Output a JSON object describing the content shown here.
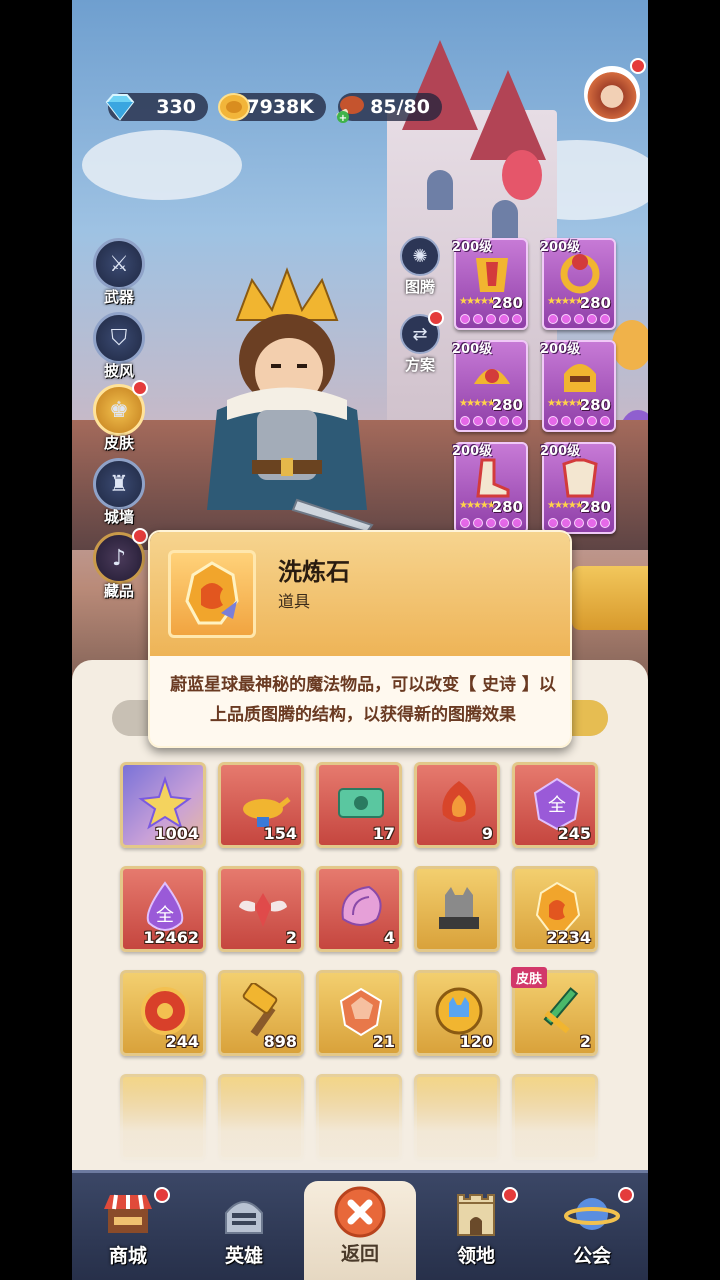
{
  "resources": {
    "gems": "330",
    "gold": "57938K",
    "stamina": "85/80"
  },
  "side_menu": [
    {
      "label": "武器",
      "icon": "weapon-icon",
      "badge": false
    },
    {
      "label": "披风",
      "icon": "cape-icon",
      "badge": false
    },
    {
      "label": "皮肤",
      "icon": "skin-icon",
      "badge": true
    },
    {
      "label": "城墙",
      "icon": "wall-icon",
      "badge": false
    },
    {
      "label": "藏品",
      "icon": "collection-icon",
      "badge": true
    }
  ],
  "mid_menu": [
    {
      "label": "图腾",
      "icon": "totem-icon",
      "badge": false
    },
    {
      "label": "方案",
      "icon": "plan-icon",
      "badge": true
    }
  ],
  "equipment": [
    {
      "level": "200级",
      "value": "280"
    },
    {
      "level": "200级",
      "value": "280"
    },
    {
      "level": "200级",
      "value": "280"
    },
    {
      "level": "200级",
      "value": "280"
    },
    {
      "level": "200级",
      "value": "280"
    },
    {
      "level": "200级",
      "value": "280"
    }
  ],
  "tooltip": {
    "name": "洗炼石",
    "type": "道具",
    "description": "蔚蓝星球最神秘的魔法物品，可以改变【 史诗 】以上品质图腾的结构，以获得新的图腾效果"
  },
  "inventory": [
    {
      "count": "1004",
      "icon": "star-crystal-icon",
      "bg": "purple"
    },
    {
      "count": "154",
      "icon": "magic-lamp-icon",
      "bg": "red"
    },
    {
      "count": "17",
      "icon": "ticket-icon",
      "bg": "red"
    },
    {
      "count": "9",
      "icon": "fire-ore-icon",
      "bg": "red"
    },
    {
      "count": "245",
      "icon": "purple-gem-icon",
      "bg": "red"
    },
    {
      "count": "12462",
      "icon": "purple-drop-icon",
      "bg": "red"
    },
    {
      "count": "2",
      "icon": "winged-crystal-icon",
      "bg": "red"
    },
    {
      "count": "4",
      "icon": "conch-icon",
      "bg": "red"
    },
    {
      "count": "",
      "icon": "cat-statue-icon",
      "bg": "gold"
    },
    {
      "count": "2234",
      "icon": "refining-stone-icon",
      "bg": "gold"
    },
    {
      "count": "244",
      "icon": "red-token-icon",
      "bg": "gold"
    },
    {
      "count": "898",
      "icon": "hammer-icon",
      "bg": "gold"
    },
    {
      "count": "21",
      "icon": "orange-ore-icon",
      "bg": "gold"
    },
    {
      "count": "120",
      "icon": "cat-coin-icon",
      "bg": "gold"
    },
    {
      "count": "2",
      "icon": "sword-icon",
      "bg": "gold",
      "tag": "皮肤"
    }
  ],
  "nav": [
    {
      "label": "商城",
      "icon": "shop-icon",
      "badge": true
    },
    {
      "label": "英雄",
      "icon": "helmet-icon",
      "badge": false
    },
    {
      "label": "返回",
      "icon": "close-icon",
      "badge": false,
      "active": true
    },
    {
      "label": "领地",
      "icon": "castle-icon",
      "badge": true
    },
    {
      "label": "公会",
      "icon": "planet-icon",
      "badge": true
    }
  ],
  "colors": {
    "badge": "#e43b3b",
    "slot_red": "#c5463f",
    "slot_gold": "#d9a23b",
    "tooltip_text": "#6a3a22"
  }
}
